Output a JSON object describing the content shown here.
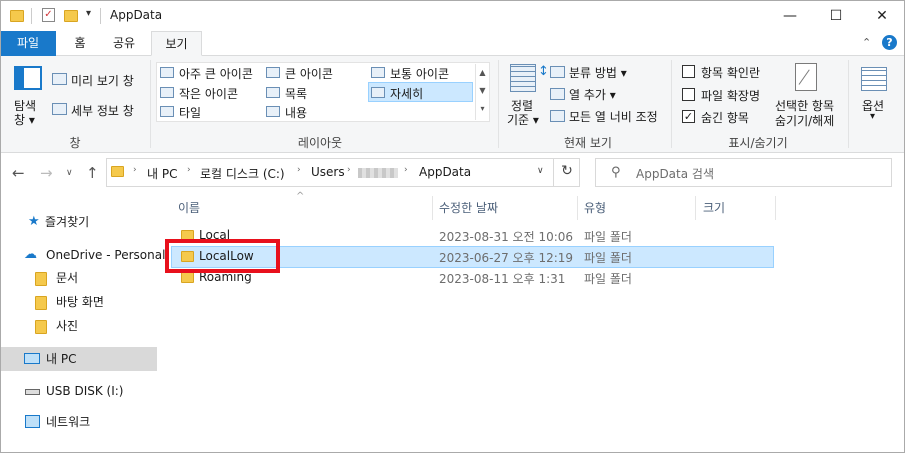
{
  "window": {
    "title": "AppData",
    "minimize": "—",
    "maximize": "☐",
    "close": "✕"
  },
  "ribbon_tabs": [
    "파일",
    "홈",
    "공유",
    "보기"
  ],
  "ribbon": {
    "panes": {
      "nav_pane_label_1": "탐색",
      "nav_pane_label_2": "창",
      "preview_pane": "미리 보기 창",
      "details_pane": "세부 정보 창",
      "group": "창"
    },
    "layout": {
      "extra_large": "아주 큰 아이콘",
      "large": "큰 아이콘",
      "medium": "보통 아이콘",
      "small": "작은 아이콘",
      "list": "목록",
      "details": "자세히",
      "tiles": "타일",
      "content": "내용",
      "group": "레이아웃"
    },
    "current_view": {
      "sort_label_1": "정렬",
      "sort_label_2": "기준",
      "group_by": "분류 방법",
      "add_columns": "열 추가",
      "size_columns": "모든 열 너비 조정",
      "group": "현재 보기"
    },
    "show_hide": {
      "item_checkboxes": "항목 확인란",
      "file_extensions": "파일 확장명",
      "hidden_items": "숨긴 항목",
      "hide_selected_1": "선택한 항목",
      "hide_selected_2": "숨기기/해제",
      "group": "표시/숨기기"
    },
    "options": "옵션"
  },
  "address": {
    "crumbs": [
      "내 PC",
      "로컬 디스크 (C:)",
      "Users",
      "AppData"
    ],
    "search_placeholder": "AppData 검색"
  },
  "nav": {
    "quick_access": "즐겨찾기",
    "onedrive": "OneDrive - Personal",
    "documents": "문서",
    "desktop": "바탕 화면",
    "pictures": "사진",
    "this_pc": "내 PC",
    "usb": "USB DISK (I:)",
    "network": "네트워크"
  },
  "columns": {
    "name": "이름",
    "modified": "수정한 날짜",
    "type": "유형",
    "size": "크기"
  },
  "files": [
    {
      "name": "Local",
      "modified": "2023-08-31 오전 10:06",
      "type": "파일 폴더"
    },
    {
      "name": "LocalLow",
      "modified": "2023-06-27 오후 12:19",
      "type": "파일 폴더"
    },
    {
      "name": "Roaming",
      "modified": "2023-08-11 오후 1:31",
      "type": "파일 폴더"
    }
  ],
  "colors": {
    "accent": "#1979ca",
    "selection": "#cce8ff",
    "highlight_box": "#e8101c"
  }
}
